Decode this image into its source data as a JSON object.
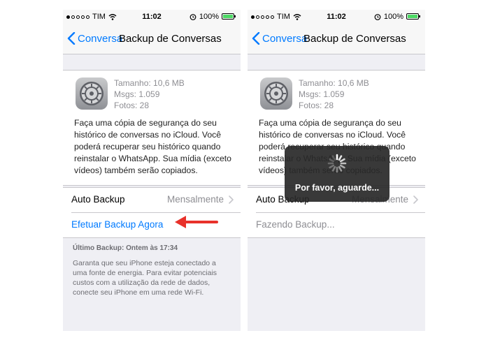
{
  "colors": {
    "accent": "#007aff",
    "arrow": "#e8312a",
    "battery": "#4cd964"
  },
  "status_bar": {
    "carrier": "TIM",
    "time": "11:02",
    "battery": "100%"
  },
  "nav": {
    "back_label": "Conversa",
    "title": "Backup de Conversas"
  },
  "backup_info": {
    "size": "Tamanho: 10,6 MB",
    "msgs": "Msgs: 1.059",
    "photos": "Fotos: 28",
    "description": "Faça uma cópia de segurança do seu histórico de conversas no iCloud. Você poderá recuperar seu histórico quando reinstalar o WhatsApp. Sua mídia (exceto vídeos) também serão copiados."
  },
  "settings": {
    "auto_backup_label": "Auto Backup",
    "auto_backup_value": "Mensalmente"
  },
  "left_screen": {
    "action_label": "Efetuar Backup Agora",
    "last_backup": "Último Backup: Ontem às 17:34",
    "footer_text": "Garanta que seu iPhone esteja conectado a uma fonte de energia. Para evitar potenciais custos com a utilização da rede de dados, conecte seu iPhone em uma rede Wi-Fi."
  },
  "right_screen": {
    "progress_label": "Fazendo Backup...",
    "hud_text": "Por favor, aguarde..."
  }
}
